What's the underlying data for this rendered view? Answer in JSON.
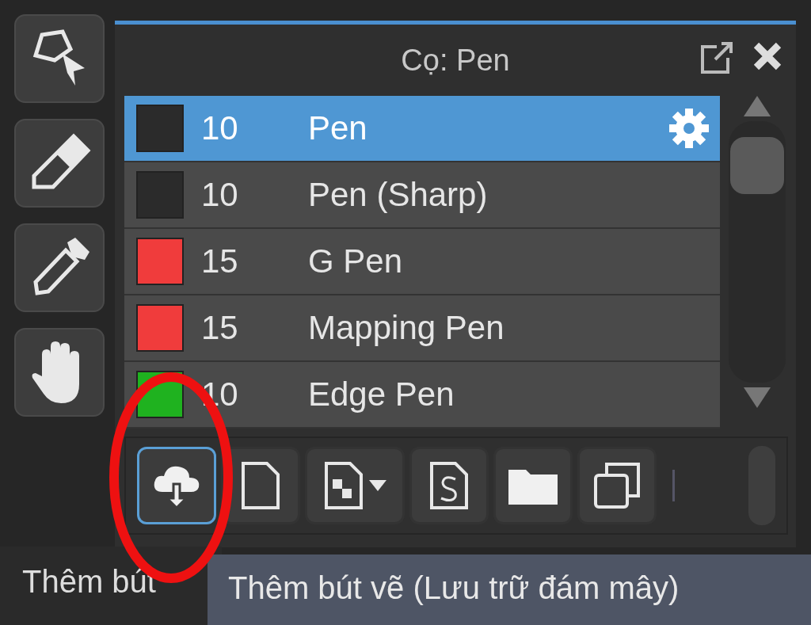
{
  "tools": [
    {
      "kind": "lasso"
    },
    {
      "kind": "eraser"
    },
    {
      "kind": "eyedropper"
    },
    {
      "kind": "hand"
    }
  ],
  "panel": {
    "title": "Cọ: Pen",
    "brushes": [
      {
        "color": "#2b2b2b",
        "size": "10",
        "name": "Pen",
        "selected": true
      },
      {
        "color": "#2b2b2b",
        "size": "10",
        "name": "Pen (Sharp)",
        "selected": false
      },
      {
        "color": "#f03c3c",
        "size": "15",
        "name": "G Pen",
        "selected": false
      },
      {
        "color": "#f03c3c",
        "size": "15",
        "name": "Mapping Pen",
        "selected": false
      },
      {
        "color": "#1fb21f",
        "size": "10",
        "name": "Edge Pen",
        "selected": false
      }
    ],
    "buttons": [
      {
        "kind": "cloud",
        "hovered": true
      },
      {
        "kind": "new",
        "hovered": false
      },
      {
        "kind": "copy",
        "hovered": false
      },
      {
        "kind": "script",
        "hovered": false
      },
      {
        "kind": "folder",
        "hovered": false
      },
      {
        "kind": "duplicate",
        "hovered": false
      }
    ]
  },
  "tooltips": [
    "Thêm bút",
    "Thêm bút vẽ (Lưu trữ đám mây)"
  ]
}
